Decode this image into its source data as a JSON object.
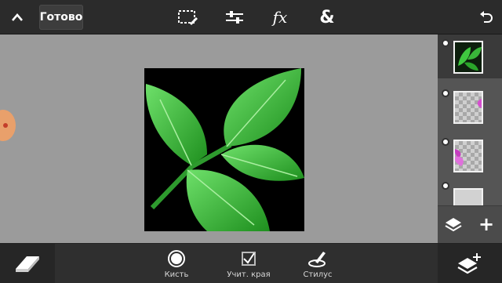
{
  "header": {
    "done_label": "Готово",
    "tools": [
      "selection-icon",
      "adjustments-icon",
      "fx-icon",
      "blend-icon"
    ],
    "fx_text": "fx",
    "blend_text": "&"
  },
  "layers": {
    "items": [
      {
        "name": "layer-leaf",
        "selected": true
      },
      {
        "name": "layer-transparent"
      },
      {
        "name": "layer-flower"
      },
      {
        "name": "layer-gray"
      }
    ],
    "add_label": "+"
  },
  "bottom": {
    "tools": [
      {
        "label": "Кисть",
        "icon": "brush-circle-icon"
      },
      {
        "label": "Учит. края",
        "icon": "edge-aware-icon"
      },
      {
        "label": "Стилус",
        "icon": "stylus-icon"
      }
    ]
  },
  "colors": {
    "toolbar": "#2b2b2b",
    "canvas_bg": "#9b9b9b",
    "leaf": "#2fb52f",
    "handle": "#e9a06b"
  }
}
